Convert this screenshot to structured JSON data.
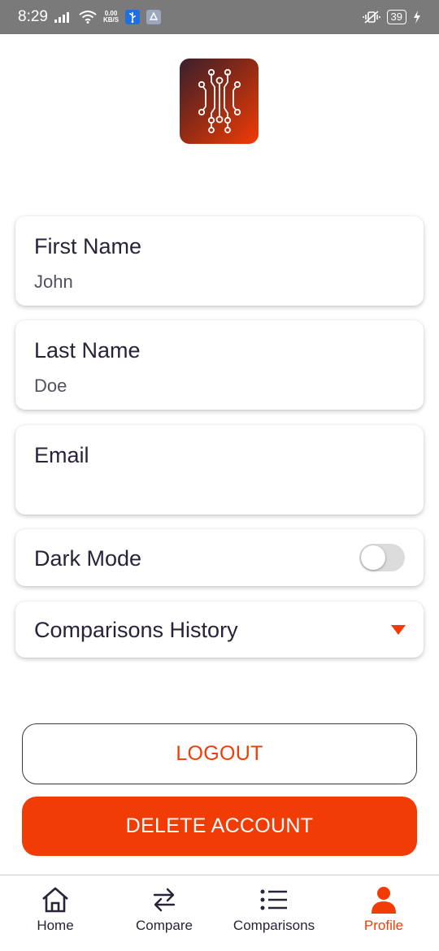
{
  "status_bar": {
    "time": "8:29",
    "net_speed_value": "0.00",
    "net_speed_unit": "KB/S",
    "battery": "39"
  },
  "icons": {
    "logo": "circuit-logo",
    "signal": "signal-icon",
    "wifi": "wifi-icon",
    "usb": "usb-icon",
    "vibrate": "vibrate-icon"
  },
  "profile": {
    "first_name_label": "First Name",
    "first_name_value": "John",
    "last_name_label": "Last Name",
    "last_name_value": "Doe",
    "email_label": "Email",
    "email_value": "",
    "dark_mode_label": "Dark Mode",
    "dark_mode_on": false,
    "history_label": "Comparisons History"
  },
  "buttons": {
    "logout": "LOGOUT",
    "delete_account": "DELETE ACCOUNT"
  },
  "nav": {
    "items": [
      {
        "label": "Home",
        "icon": "home-icon"
      },
      {
        "label": "Compare",
        "icon": "compare-icon"
      },
      {
        "label": "Comparisons",
        "icon": "list-icon"
      },
      {
        "label": "Profile",
        "icon": "person-icon"
      }
    ],
    "active": "Profile"
  },
  "colors": {
    "accent": "#f23c06",
    "text": "#2a2238",
    "status_bar": "#7a7a7a"
  }
}
